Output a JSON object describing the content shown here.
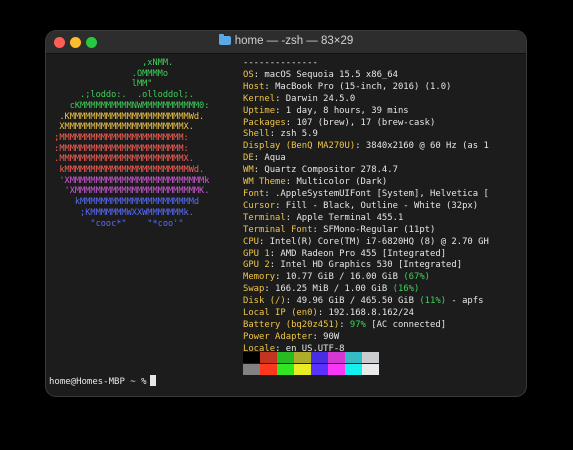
{
  "window": {
    "title": "home — -zsh — 83×29"
  },
  "logo": {
    "lines": [
      {
        "text": "                  ,xNMM.",
        "color": "#3fd15a"
      },
      {
        "text": "                .OMMMMo",
        "color": "#3fd15a"
      },
      {
        "text": "                lMM\"",
        "color": "#3fd15a"
      },
      {
        "text": "      .;loddo:.  .olloddol;.",
        "color": "#3fd15a"
      },
      {
        "text": "    cKMMMMMMMMMMNWMMMMMMMMMMM0:",
        "color": "#3fd15a"
      },
      {
        "text": "  .KMMMMMMMMMMMMMMMMMMMMMMMWd.",
        "color": "#f0c548"
      },
      {
        "text": "  XMMMMMMMMMMMMMMMMMMMMMMMX.",
        "color": "#f0c548"
      },
      {
        "text": " ;MMMMMMMMMMMMMMMMMMMMMMMM:",
        "color": "#ff5f56"
      },
      {
        "text": " :MMMMMMMMMMMMMMMMMMMMMMMM:",
        "color": "#ff5f56"
      },
      {
        "text": " .MMMMMMMMMMMMMMMMMMMMMMMMX.",
        "color": "#ff5f56"
      },
      {
        "text": "  kMMMMMMMMMMMMMMMMMMMMMMMMWd.",
        "color": "#ff5f56"
      },
      {
        "text": "  'XMMMMMMMMMMMMMMMMMMMMMMMMMMk",
        "color": "#d45adb"
      },
      {
        "text": "   'XMMMMMMMMMMMMMMMMMMMMMMMMK.",
        "color": "#d45adb"
      },
      {
        "text": "     kMMMMMMMMMMMMMMMMMMMMMMd",
        "color": "#5a6cff"
      },
      {
        "text": "      ;KMMMMMMMWXXWMMMMMMMk.",
        "color": "#5a6cff"
      },
      {
        "text": "        \"cooc*\"    \"*coo'\"",
        "color": "#5a6cff"
      }
    ]
  },
  "info": {
    "separator": "--------------",
    "rows": [
      {
        "label": "OS",
        "value": "macOS Sequoia 15.5 x86_64"
      },
      {
        "label": "Host",
        "value": "MacBook Pro (15-inch, 2016) (1.0)"
      },
      {
        "label": "Kernel",
        "value": "Darwin 24.5.0"
      },
      {
        "label": "Uptime",
        "value": "1 day, 8 hours, 39 mins"
      },
      {
        "label": "Packages",
        "value": "107 (brew), 17 (brew-cask)"
      },
      {
        "label": "Shell",
        "value": "zsh 5.9"
      },
      {
        "label": "Display (BenQ MA270U)",
        "value": "3840x2160 @ 60 Hz (as 1"
      },
      {
        "label": "DE",
        "value": "Aqua"
      },
      {
        "label": "WM",
        "value": "Quartz Compositor 278.4.7"
      },
      {
        "label": "WM Theme",
        "value": "Multicolor (Dark)"
      },
      {
        "label": "Font",
        "value": ".AppleSystemUIFont [System], Helvetica ["
      },
      {
        "label": "Cursor",
        "value": "Fill - Black, Outline - White (32px)"
      },
      {
        "label": "Terminal",
        "value": "Apple Terminal 455.1"
      },
      {
        "label": "Terminal Font",
        "value": "SFMono-Regular (11pt)"
      },
      {
        "label": "CPU",
        "value": "Intel(R) Core(TM) i7-6820HQ (8) @ 2.70 GH"
      },
      {
        "label": "GPU 1",
        "value": "AMD Radeon Pro 455 [Integrated]"
      },
      {
        "label": "GPU 2",
        "value": "Intel HD Graphics 530 [Integrated]"
      },
      {
        "label": "Memory",
        "value": "10.77 GiB / 16.00 GiB ",
        "pct": "(67%)"
      },
      {
        "label": "Swap",
        "value": "166.25 MiB / 1.00 GiB ",
        "pct": "(16%)"
      },
      {
        "label": "Disk (/)",
        "value": "49.96 GiB / 465.50 GiB ",
        "pct": "(11%)",
        "suffix": " - apfs"
      },
      {
        "label": "Local IP (en0)",
        "value": "192.168.8.162/24"
      },
      {
        "label": "Battery (bq20z451)",
        "value": "",
        "pct": "97%",
        "suffix": " [AC connected]"
      },
      {
        "label": "Power Adapter",
        "value": "90W"
      },
      {
        "label": "Locale",
        "value": "en_US.UTF-8"
      }
    ]
  },
  "palette": {
    "row1": [
      "#000000",
      "#c23621",
      "#25bc24",
      "#adad27",
      "#492ee1",
      "#d338d3",
      "#33bbc8",
      "#cbcccd"
    ],
    "row2": [
      "#818383",
      "#fc391f",
      "#31e722",
      "#eaec23",
      "#5833ff",
      "#f935f8",
      "#14f0f0",
      "#e9ebeb"
    ]
  },
  "prompt": {
    "text": "home@Homes-MBP ~ %"
  }
}
